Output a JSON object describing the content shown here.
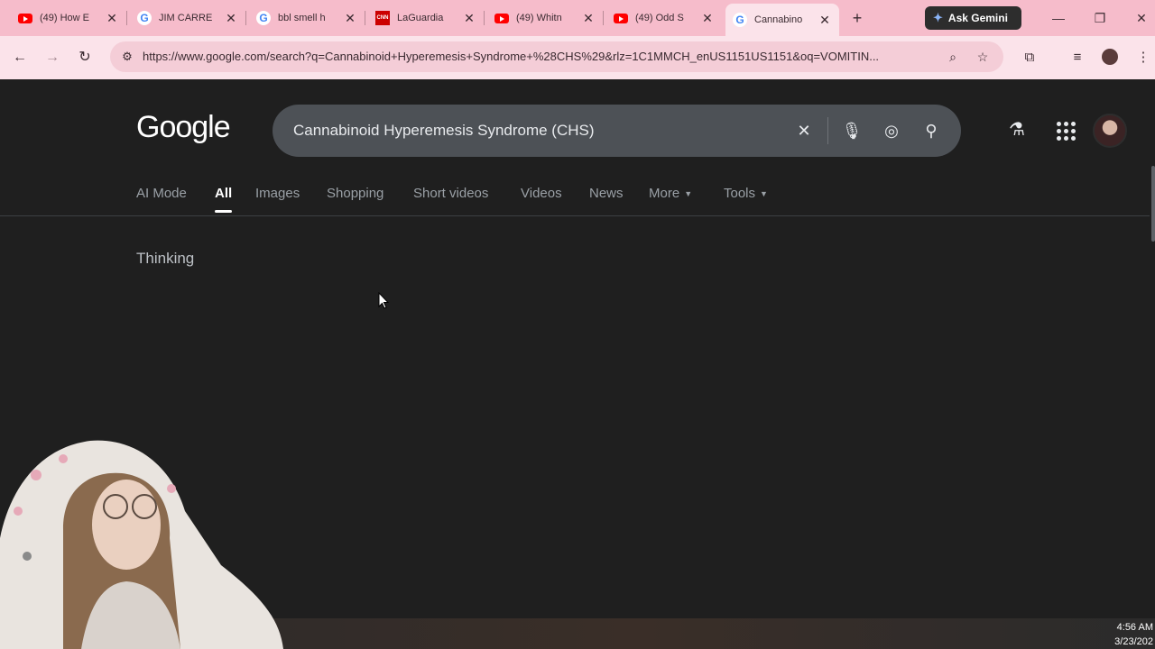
{
  "browser": {
    "tabs": [
      {
        "title": "(49) How E",
        "favicon": "youtube-icon"
      },
      {
        "title": "JIM CARRE",
        "favicon": "google-icon"
      },
      {
        "title": "bbl smell h",
        "favicon": "google-icon"
      },
      {
        "title": "LaGuardia",
        "favicon": "cnn-icon"
      },
      {
        "title": "(49) Whitn",
        "favicon": "youtube-icon"
      },
      {
        "title": "(49) Odd S",
        "favicon": "youtube-icon"
      },
      {
        "title": "Cannabino",
        "favicon": "google-icon",
        "active": true
      }
    ],
    "new_tab": "+",
    "gemini_label": "Ask Gemini",
    "url": "https://www.google.com/search?q=Cannabinoid+Hyperemesis+Syndrome+%28CHS%29&rlz=1C1MMCH_enUS1151US1151&oq=VOMITIN..."
  },
  "google": {
    "logo": "Google",
    "query": "Cannabinoid Hyperemesis Syndrome (CHS)",
    "tabs": [
      "AI Mode",
      "All",
      "Images",
      "Shopping",
      "Short videos",
      "Videos",
      "News",
      "More",
      "Tools"
    ],
    "active_tab": "All",
    "status": "Thinking"
  },
  "taskbar": {
    "time": "4:56 AM",
    "date": "3/23/202"
  },
  "colors": {
    "tabstrip": "#f6bccb",
    "toolbar": "#fbe3ea",
    "page_bg": "#1f1f1f",
    "searchbox": "#4d5156"
  }
}
